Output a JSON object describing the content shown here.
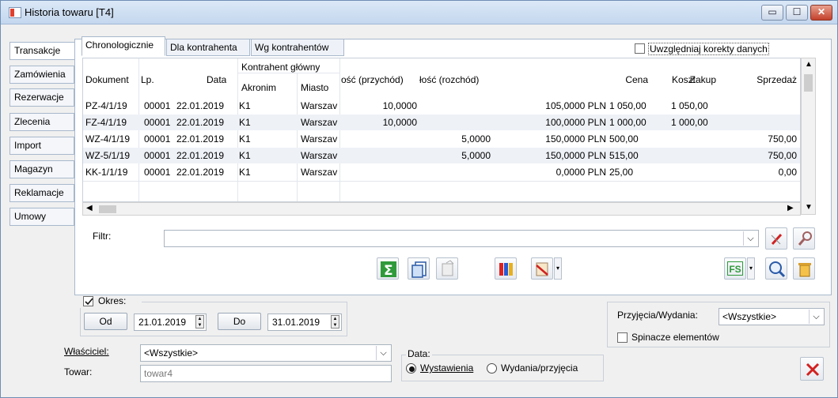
{
  "window": {
    "title": "Historia towaru [T4]",
    "controls": {
      "minimize": "▭",
      "maximize": "☐",
      "close": "✕"
    }
  },
  "left_tabs": [
    "Transakcje",
    "Zamówienia",
    "Rezerwacje",
    "Zlecenia",
    "Import",
    "Magazyn",
    "Reklamacje",
    "Umowy"
  ],
  "sub_tabs": [
    "Chronologicznie",
    "Dla kontrahenta",
    "Wg kontrahentów"
  ],
  "corrections_checkbox": {
    "label": "Uwzględniaj korekty danych",
    "checked": false
  },
  "grid": {
    "group_header": "Kontrahent główny",
    "columns": [
      "Dokument",
      "Lp.",
      "Data",
      "Akronim",
      "Miasto",
      "ość (przychód)",
      "łość (rozchód)",
      "Cena",
      "Koszt",
      "Zakup",
      "Sprzedaż"
    ],
    "rows": [
      [
        "PZ-4/1/19",
        "00001",
        "22.01.2019",
        "K1",
        "Warszav",
        "10,0000",
        "",
        "105,0000 PLN",
        "1 050,00",
        "1 050,00",
        ""
      ],
      [
        "FZ-4/1/19",
        "00001",
        "22.01.2019",
        "K1",
        "Warszav",
        "10,0000",
        "",
        "100,0000 PLN",
        "1 000,00",
        "1 000,00",
        ""
      ],
      [
        "WZ-4/1/19",
        "00001",
        "22.01.2019",
        "K1",
        "Warszav",
        "",
        "5,0000",
        "150,0000 PLN",
        "500,00",
        "",
        "750,00"
      ],
      [
        "WZ-5/1/19",
        "00001",
        "22.01.2019",
        "K1",
        "Warszav",
        "",
        "5,0000",
        "150,0000 PLN",
        "515,00",
        "",
        "750,00"
      ],
      [
        "KK-1/1/19",
        "00001",
        "22.01.2019",
        "K1",
        "Warszav",
        "",
        "",
        "0,0000 PLN",
        "25,00",
        "",
        "0,00"
      ]
    ]
  },
  "filter": {
    "label": "Filtr:",
    "value": ""
  },
  "toolbar_icons": [
    "sum-icon",
    "export-icon",
    "print-icon",
    "columns-icon",
    "edit-list-icon",
    "fs-icon",
    "search-icon",
    "trash-icon"
  ],
  "toolbar_fs_label": "FS",
  "period": {
    "checkbox_label": "Okres:",
    "checked": true,
    "from_button": "Od",
    "from_date": "21.01.2019",
    "to_button": "Do",
    "to_date": "31.01.2019"
  },
  "owner": {
    "label": "Właściciel:",
    "value": "<Wszystkie>"
  },
  "product": {
    "label": "Towar:",
    "value": "towar4"
  },
  "date_group": {
    "label": "Data:",
    "option1": "Wystawienia",
    "option2": "Wydania/przyjęcia",
    "selected": "Wystawienia"
  },
  "receipts": {
    "label": "Przyjęcia/Wydania:",
    "value": "<Wszystkie>"
  },
  "clips_checkbox": {
    "label": "Spinacze elementów",
    "checked": false
  },
  "colors": {
    "accent_red": "#d22020",
    "selection": "#eef1f6"
  }
}
